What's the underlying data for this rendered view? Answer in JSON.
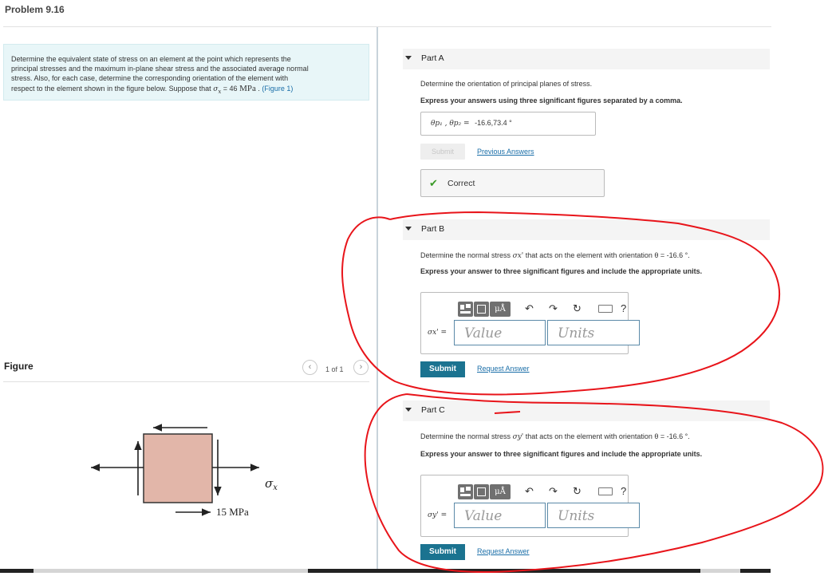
{
  "page": {
    "title": "Problem 9.16"
  },
  "problem": {
    "text_lines": [
      "Determine the equivalent state of stress on an element at the point which represents the",
      "principal stresses and the maximum in-plane shear stress and the associated average normal",
      "stress. Also, for each case, determine the corresponding orientation of the element with",
      "respect to the element shown in the figure below. Suppose that"
    ],
    "sigma_symbol": "σ",
    "sigma_subscript": "x",
    "equals_value": " = 46 ",
    "unit": "MPa",
    "period": " .",
    "figure_link": "(Figure 1)"
  },
  "figure": {
    "label": "Figure",
    "pager_prev": "‹",
    "pager_next": "›",
    "pager_text": "1 of 1",
    "sigma_label": "σ",
    "sigma_sub": "x",
    "stress_label": "15 MPa",
    "element_color": "#e2b6a9"
  },
  "partA": {
    "header": "Part A",
    "question": "Determine the orientation of principal planes of stress.",
    "instruction": "Express your answers using three significant figures separated by a comma.",
    "answer_lhs": "θp₁ , θp₂ =",
    "answer_value": "-16.6,73.4 °",
    "submit_label": "Submit",
    "previous_answers_label": "Previous Answers",
    "feedback_icon": "check-icon",
    "feedback": "Correct"
  },
  "partB": {
    "header": "Part B",
    "question_pre": "Determine the normal stress",
    "question_sym": "σx'",
    "question_post": "that acts on the element with orientation θ = -16.6 °.",
    "instruction": "Express your answer to three significant figures and include the appropriate units.",
    "var_label": "σx' =",
    "value_placeholder": "Value",
    "units_placeholder": "Units",
    "submit_label": "Submit",
    "request_label": "Request Answer"
  },
  "partC": {
    "header": "Part C",
    "question_pre": "Determine the normal stress",
    "question_sym": "σy'",
    "question_post": "that acts on the element with orientation θ = -16.6 °.",
    "instruction": "Express your answer to three significant figures and include the appropriate units.",
    "var_label": "σy' =",
    "value_placeholder": "Value",
    "units_placeholder": "Units",
    "submit_label": "Submit",
    "request_label": "Request Answer"
  },
  "toolbar": {
    "template_icon": "template-icon",
    "units_label": "μÅ",
    "undo_icon": "undo-icon",
    "redo_icon": "redo-icon",
    "reset_icon": "reset-icon",
    "keyboard_icon": "keyboard-icon",
    "help_label": "?"
  },
  "colors": {
    "annotation": "#e8141a",
    "submit": "#1b7390",
    "link": "#1a6ea8",
    "correct": "#3a9a27"
  }
}
